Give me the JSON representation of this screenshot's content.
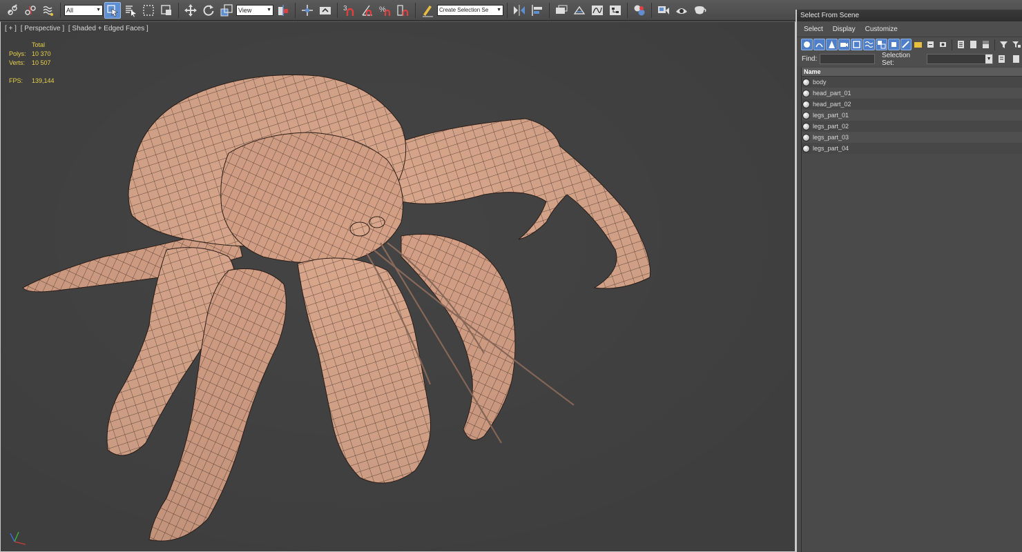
{
  "toolbar": {
    "selection_filter": "All",
    "reference_coord": "View",
    "named_selection_placeholder": "Create Selection Se",
    "snap_3d_label": "3",
    "percent_snap_label": "%"
  },
  "viewport": {
    "labels": [
      "[ + ]",
      "[ Perspective ]",
      "[ Shaded + Edged Faces ]"
    ],
    "stats": {
      "header": "Total",
      "polys_label": "Polys:",
      "polys_value": "10 370",
      "verts_label": "Verts:",
      "verts_value": "10 507",
      "fps_label": "FPS:",
      "fps_value": "139,144"
    },
    "colors": {
      "mesh_fill": "#d9a78c",
      "wire": "#3b2a22",
      "background": "#444444",
      "stats_text": "#e8d24a"
    }
  },
  "panel": {
    "title": "Select From Scene",
    "menu": [
      "Select",
      "Display",
      "Customize"
    ],
    "find_label": "Find:",
    "selection_set_label": "Selection Set:",
    "column_name": "Name",
    "objects": [
      "body",
      "head_part_01",
      "head_part_02",
      "legs_part_01",
      "legs_part_02",
      "legs_part_03",
      "legs_part_04"
    ]
  }
}
